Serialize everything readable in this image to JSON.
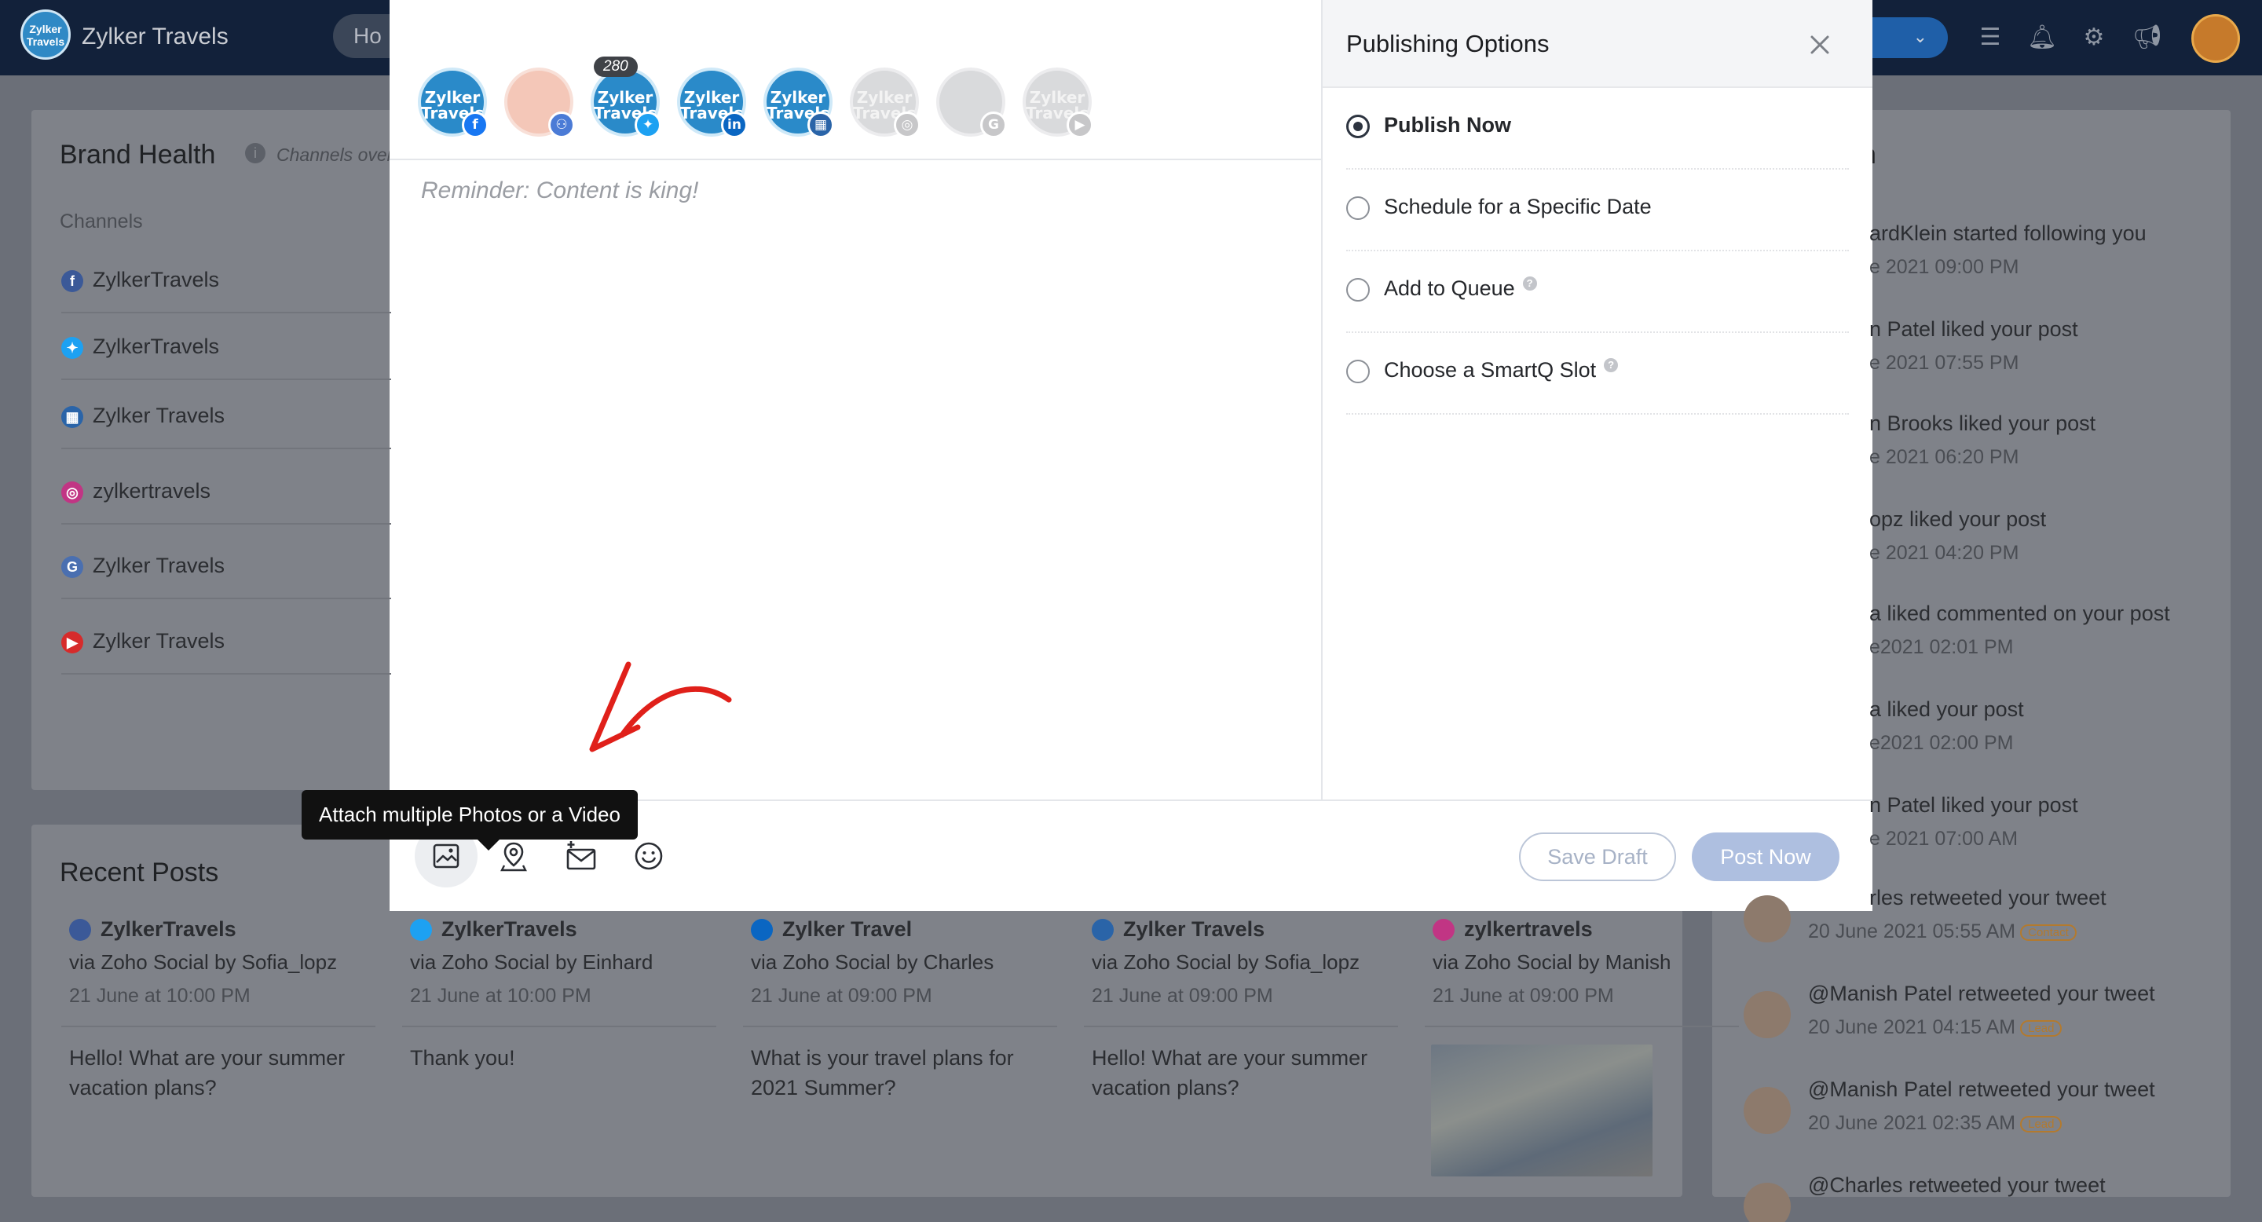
{
  "app": {
    "name": "Zylker Travels",
    "logo_text": "Zylker Travels",
    "nav_first": "Ho"
  },
  "brand_health": {
    "title": "Brand Health",
    "subtitle": "Channels over",
    "channels_label": "Channels",
    "channels": [
      {
        "name": "ZylkerTravels",
        "network": "facebook",
        "color": "#3b5998"
      },
      {
        "name": "ZylkerTravels",
        "network": "twitter",
        "color": "#1da1f2"
      },
      {
        "name": "Zylker Travels",
        "network": "linkedin-page",
        "color": "#2a64a8"
      },
      {
        "name": "zylkertravels",
        "network": "instagram",
        "color": "#c13584"
      },
      {
        "name": "Zylker Travels",
        "network": "google",
        "color": "#4a6fb0"
      },
      {
        "name": "Zylker Travels",
        "network": "youtube",
        "color": "#d62b2b"
      }
    ]
  },
  "activity": {
    "title_tail": "n",
    "items": [
      {
        "text": "ardKlein started following you",
        "time": "e 2021 09:00 PM"
      },
      {
        "text": "n Patel liked your post",
        "time": "e 2021 07:55 PM"
      },
      {
        "text": "n Brooks liked your post",
        "time": "e 2021 06:20 PM"
      },
      {
        "text": "opz liked your post",
        "time": "e 2021 04:20 PM"
      },
      {
        "text": "a liked commented on your post",
        "time": "e2021 02:01 PM"
      },
      {
        "text": "a liked your post",
        "time": "e2021 02:00 PM"
      },
      {
        "text": "n Patel liked your post",
        "time": "e 2021 07:00 AM"
      },
      {
        "text": "rles retweeted your tweet",
        "time": "20 June 2021 05:55 AM",
        "tag": "Contact"
      },
      {
        "text": "@Manish Patel  retweeted your tweet",
        "time": "20 June 2021 04:15 AM",
        "tag": "Lead"
      },
      {
        "text": "@Manish Patel  retweeted your tweet",
        "time": "20 June 2021 02:35 AM",
        "tag": "Lead"
      },
      {
        "text": "@Charles retweeted your tweet",
        "time": ""
      }
    ]
  },
  "recent_posts": {
    "title": "Recent Posts",
    "posts": [
      {
        "account": "ZylkerTravels",
        "via": "via Zoho Social by Sofia_lopz",
        "time": "21 June at 10:00 PM",
        "text1": "Hello! What are your summer",
        "text2": "vacation plans?",
        "color": "#3b5998"
      },
      {
        "account": "ZylkerTravels",
        "via": "via Zoho Social by Einhard",
        "time": "21 June at 10:00 PM",
        "text1": "Thank you!",
        "text2": "",
        "color": "#1da1f2"
      },
      {
        "account": "Zylker Travel",
        "via": "via Zoho Social by Charles",
        "time": "21 June at 09:00 PM",
        "text1": "What is your travel plans for",
        "text2": "2021 Summer?",
        "color": "#0a66c2"
      },
      {
        "account": "Zylker Travels",
        "via": "via Zoho Social by  Sofia_lopz",
        "time": "21 June at 09:00 PM",
        "text1": "Hello! What are your summer",
        "text2": "vacation plans?",
        "color": "#2a64a8"
      },
      {
        "account": "zylkertravels",
        "via": "via Zoho Social by  Manish",
        "time": "21 June at 09:00 PM",
        "text1": "",
        "text2": "",
        "color": "#c13584"
      }
    ]
  },
  "composer": {
    "profiles": [
      {
        "label": "Zylker Travels",
        "network": "facebook",
        "badge_color": "#1877f2",
        "badge_glyph": "f",
        "active": true
      },
      {
        "label": "",
        "network": "facebook-group",
        "badge_color": "#4b7bd6",
        "badge_glyph": "⚇",
        "active": true
      },
      {
        "label": "Zylker Travels",
        "network": "twitter",
        "badge_color": "#1da1f2",
        "badge_glyph": "✦",
        "active": true,
        "count": "280"
      },
      {
        "label": "Zylker Travels",
        "network": "linkedin",
        "badge_color": "#0a66c2",
        "badge_glyph": "in",
        "active": true
      },
      {
        "label": "Zylker Travels",
        "network": "linkedin-page",
        "badge_color": "#2a64a8",
        "badge_glyph": "▦",
        "active": true
      },
      {
        "label": "Zylker Travels",
        "network": "instagram",
        "badge_color": "#c7c7c9",
        "badge_glyph": "◎",
        "active": false
      },
      {
        "label": "",
        "network": "google-business",
        "badge_color": "#c7c7c9",
        "badge_glyph": "G",
        "active": false
      },
      {
        "label": "Zylker Travels",
        "network": "youtube",
        "badge_color": "#c7c7c9",
        "badge_glyph": "▶",
        "active": false
      }
    ],
    "placeholder": "Reminder: Content is king!",
    "tooltip": "Attach multiple Photos or a Video",
    "save_draft": "Save Draft",
    "post_now": "Post Now"
  },
  "publishing": {
    "title": "Publishing Options",
    "options": [
      {
        "label": "Publish Now",
        "selected": true,
        "help": false
      },
      {
        "label": "Schedule for a Specific Date",
        "selected": false,
        "help": false
      },
      {
        "label": "Add to Queue",
        "selected": false,
        "help": true
      },
      {
        "label": "Choose a SmartQ Slot",
        "selected": false,
        "help": true
      }
    ]
  },
  "colors": {
    "arrow": "#e0201a",
    "primary_disabled": "#aebfe0"
  }
}
